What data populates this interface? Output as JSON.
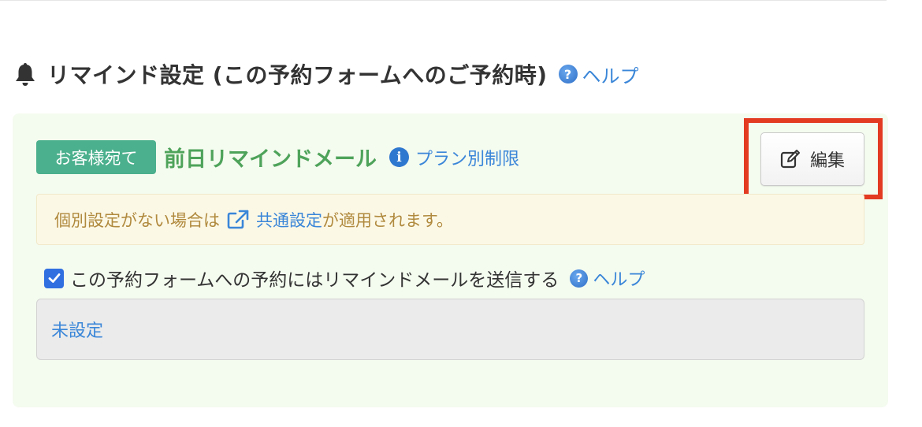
{
  "section": {
    "title": "リマインド設定 (この予約フォームへのご予約時)",
    "help_label": "ヘルプ",
    "bell_icon": "bell-icon",
    "help_icon": "question-circle-icon"
  },
  "reminder": {
    "badge_label": "お客様宛て",
    "mail_title": "前日リマインドメール",
    "plan_label": "プラン別制限",
    "info_icon": "info-circle-icon",
    "edit_label": "編集",
    "edit_icon": "edit-icon",
    "notice_prefix": "個別設定がない場合は",
    "notice_link": "共通設定",
    "notice_suffix": "が適用されます。",
    "notice_icon": "external-link-icon",
    "checkbox_label": "この予約フォームへの予約にはリマインドメールを送信する",
    "checkbox_checked": true,
    "checkbox_help_label": "ヘルプ",
    "unset_label": "未設定"
  },
  "colors": {
    "badge": "#4bb08d",
    "mail_title": "#4ea35a",
    "link": "#3a86d8",
    "panel_bg": "#f4fbef",
    "notice_bg": "#fcf8e6",
    "notice_text": "#b08a3e",
    "highlight": "#e23b22",
    "checkbox": "#2f6fe0"
  }
}
